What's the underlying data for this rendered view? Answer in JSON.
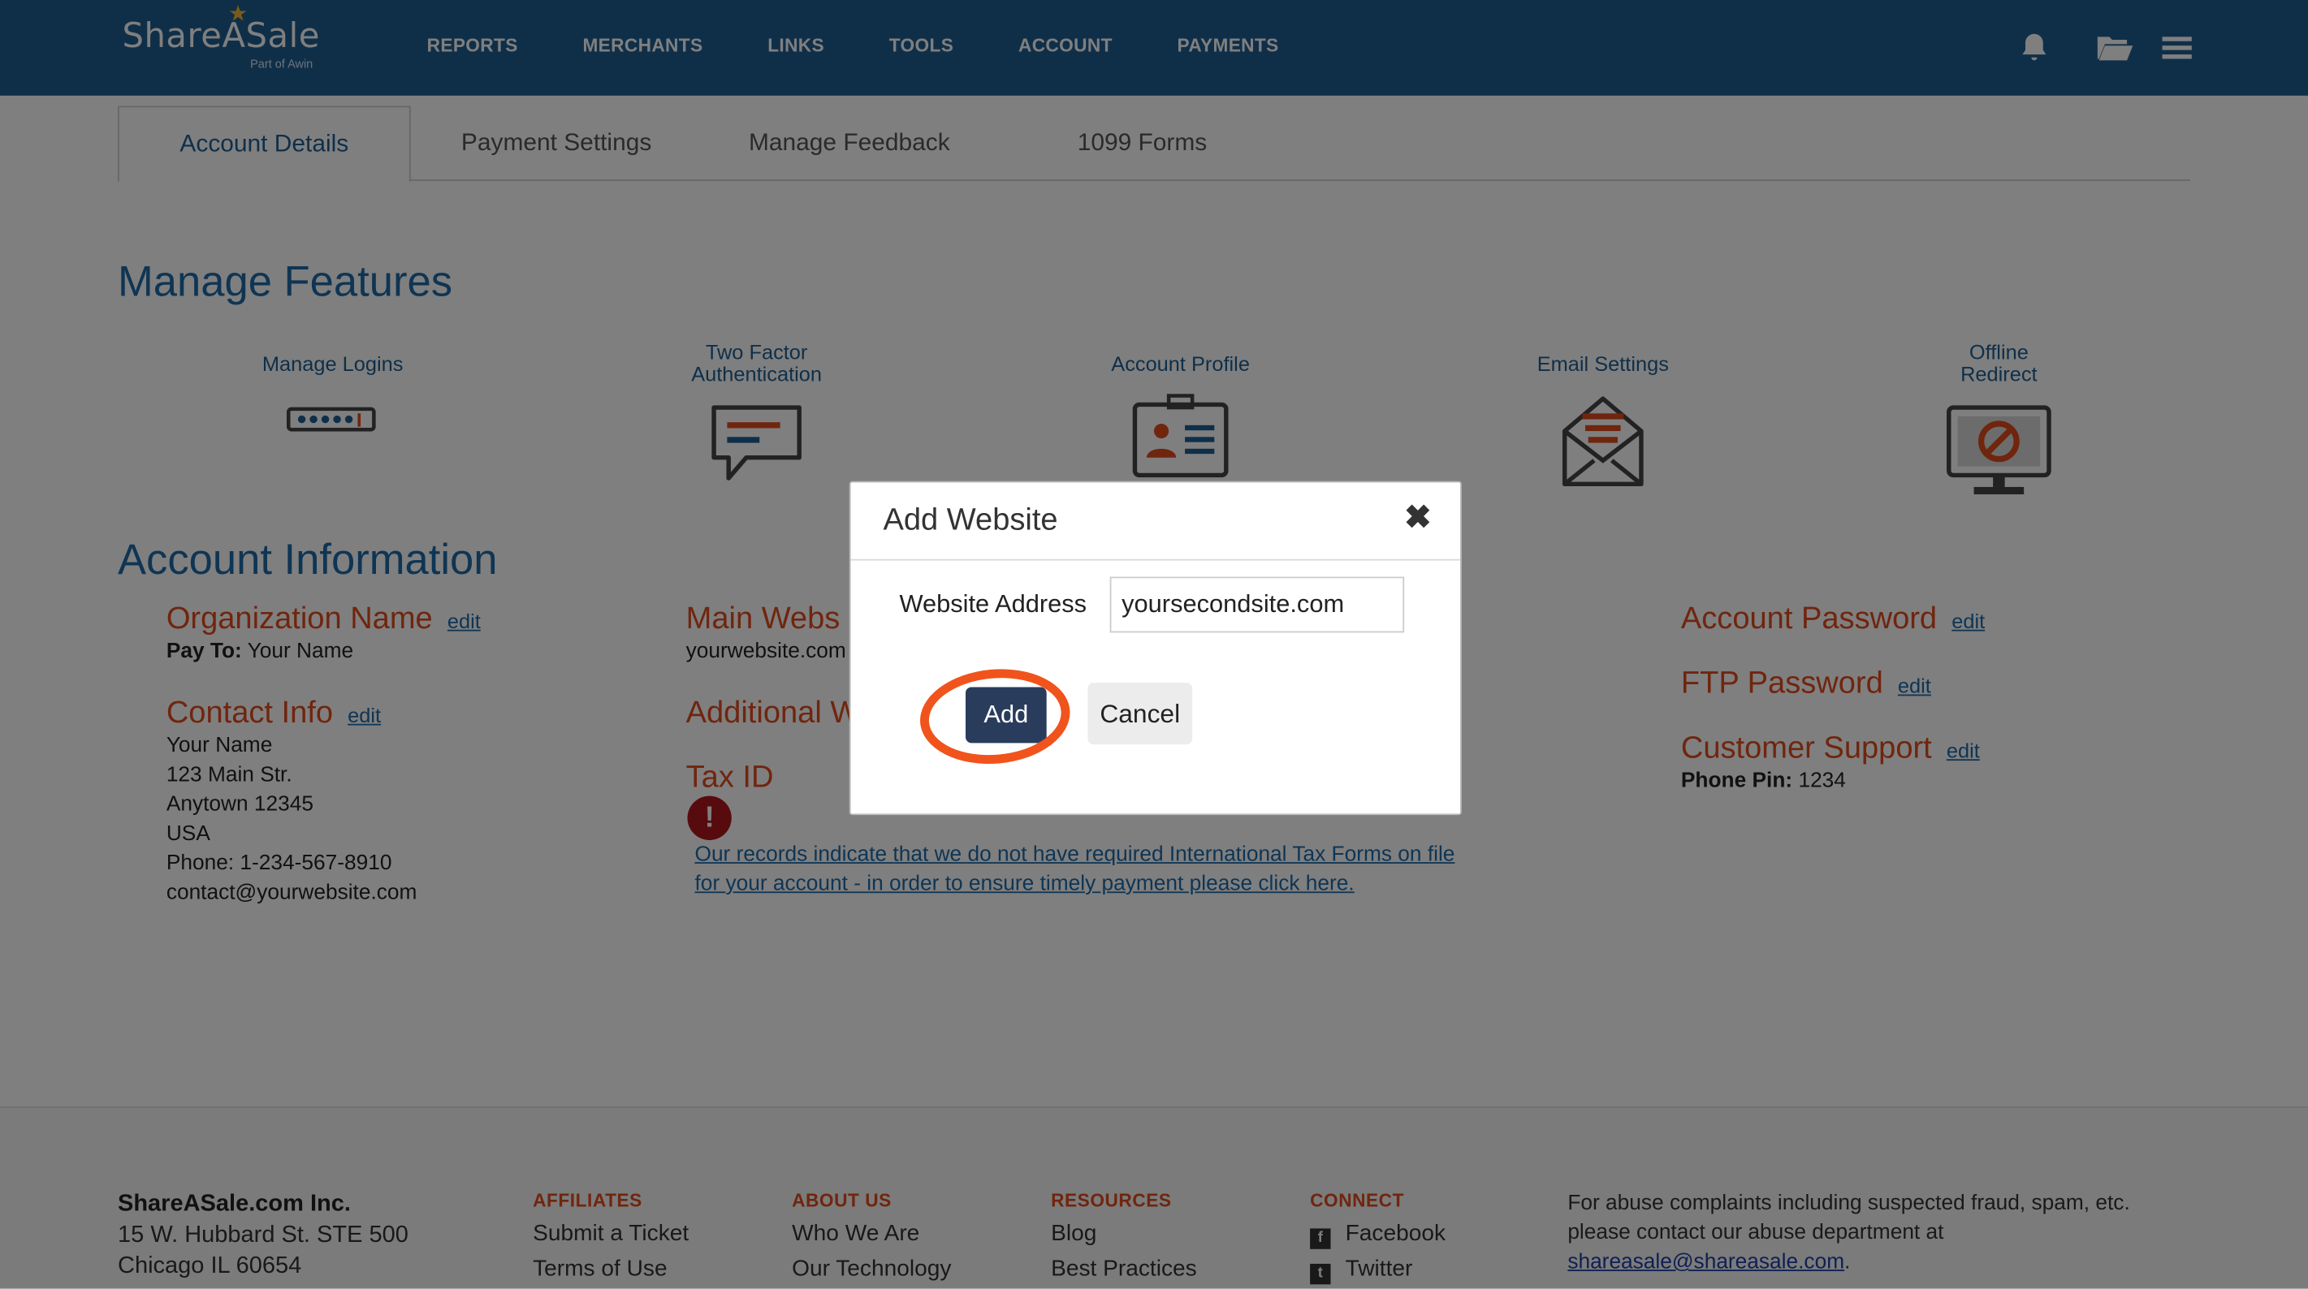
{
  "header": {
    "logo": "ShareASale",
    "logo_sub": "Part of Awin",
    "nav": [
      "REPORTS",
      "MERCHANTS",
      "LINKS",
      "TOOLS",
      "ACCOUNT",
      "PAYMENTS"
    ],
    "icons": [
      "bell-icon",
      "folder-icon",
      "hamburger-menu-icon"
    ]
  },
  "tabs": [
    "Account Details",
    "Payment Settings",
    "Manage Feedback",
    "1099 Forms"
  ],
  "manage_features": {
    "title": "Manage Features",
    "items": [
      {
        "line1": "Manage Logins",
        "line2": ""
      },
      {
        "line1": "Two Factor",
        "line2": "Authentication"
      },
      {
        "line1": "Account Profile",
        "line2": ""
      },
      {
        "line1": "Email Settings",
        "line2": ""
      },
      {
        "line1": "Offline",
        "line2": "Redirect"
      }
    ]
  },
  "account_info": {
    "title": "Account Information",
    "edit": "edit",
    "org_name": {
      "title": "Organization Name",
      "pay_to_label": "Pay To:",
      "pay_to_value": "Your Name"
    },
    "contact": {
      "title": "Contact Info",
      "lines": [
        "Your Name",
        "123 Main Str.",
        "Anytown 12345",
        "USA",
        "Phone: 1-234-567-8910",
        "contact@yourwebsite.com"
      ]
    },
    "main_website": {
      "title": "Main Webs",
      "value": "yourwebsite.com"
    },
    "additional": {
      "title": "Additional W"
    },
    "tax_id": {
      "title": "Tax ID",
      "warning_icon": "!",
      "warning_line1": "Our records indicate that we do not have required International Tax Forms on file",
      "warning_line2": "for your account - in order to ensure timely payment please click here."
    },
    "account_password": {
      "title": "Account Password"
    },
    "ftp_password": {
      "title": "FTP Password"
    },
    "customer_support": {
      "title": "Customer Support",
      "pin_label": "Phone Pin:",
      "pin_value": "1234"
    }
  },
  "footer": {
    "company": {
      "name": "ShareASale.com Inc.",
      "address1": "15 W. Hubbard St. STE 500",
      "address2": "Chicago IL 60654"
    },
    "affiliates": {
      "heading": "AFFILIATES",
      "links": [
        "Submit a Ticket",
        "Terms of Use"
      ]
    },
    "about": {
      "heading": "ABOUT US",
      "links": [
        "Who We Are",
        "Our Technology"
      ]
    },
    "resources": {
      "heading": "RESOURCES",
      "links": [
        "Blog",
        "Best Practices"
      ]
    },
    "connect": {
      "heading": "CONNECT",
      "links": [
        "Facebook",
        "Twitter"
      ],
      "icons": [
        "f",
        "t"
      ]
    },
    "abuse": {
      "line1": "For abuse complaints including suspected fraud, spam, etc.",
      "line2": "please contact our abuse department at",
      "email": "shareasale@shareasale.com",
      "period": "."
    }
  },
  "modal": {
    "title": "Add Website",
    "close": "✖",
    "label": "Website Address",
    "input_value": "yoursecondsite.com",
    "add_label": "Add",
    "cancel_label": "Cancel"
  },
  "colors": {
    "header": "#1f5f92",
    "accent_orange": "#e04b1c",
    "link_blue": "#1f6aa8",
    "highlight": "#f0541c",
    "add_button": "#2a3c5c"
  }
}
